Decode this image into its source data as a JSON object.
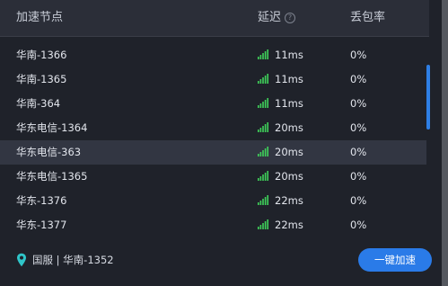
{
  "header": {
    "node_label": "加速节点",
    "delay_label": "延迟",
    "loss_label": "丢包率",
    "help_glyph": "?"
  },
  "rows": [
    {
      "name": "华南-1366",
      "latency": "11ms",
      "loss": "0%",
      "selected": false
    },
    {
      "name": "华南-1365",
      "latency": "11ms",
      "loss": "0%",
      "selected": false
    },
    {
      "name": "华南-364",
      "latency": "11ms",
      "loss": "0%",
      "selected": false
    },
    {
      "name": "华东电信-1364",
      "latency": "20ms",
      "loss": "0%",
      "selected": false
    },
    {
      "name": "华东电信-363",
      "latency": "20ms",
      "loss": "0%",
      "selected": true
    },
    {
      "name": "华东电信-1365",
      "latency": "20ms",
      "loss": "0%",
      "selected": false
    },
    {
      "name": "华东-1376",
      "latency": "22ms",
      "loss": "0%",
      "selected": false
    },
    {
      "name": "华东-1377",
      "latency": "22ms",
      "loss": "0%",
      "selected": false
    }
  ],
  "footer": {
    "current_node": "国服 | 华南-1352",
    "boost_button": "一键加速"
  },
  "colors": {
    "accent": "#2a7be8",
    "signal": "#3fd15a",
    "selected_row": "#323642"
  },
  "icons": {
    "signal": "signal-bars-icon",
    "location": "location-pin-icon",
    "help": "question-circle-icon"
  }
}
